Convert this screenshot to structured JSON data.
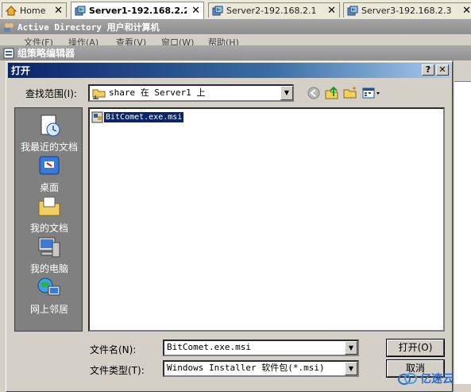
{
  "vmware_tabs": [
    {
      "label": "Home"
    },
    {
      "label": "Server1-192.168.2.2"
    },
    {
      "label": "Server2-192.168.2.1"
    },
    {
      "label": "Server3-192.168.2.3"
    }
  ],
  "ad_window": {
    "title": "Active Directory 用户和计算机",
    "menu": [
      "文件(F)",
      "操作(A)",
      "查看(V)",
      "窗口(W)",
      "帮助(H)"
    ]
  },
  "gpo_window": {
    "title": "组策略编辑器"
  },
  "dialog": {
    "title": "打开",
    "help_label": "?",
    "close_label": "✕",
    "look_in_label": "查找范围(I):",
    "look_in_value": "share 在 Server1 上",
    "places": [
      {
        "label": "我最近的文档",
        "icon": "recent-documents-icon"
      },
      {
        "label": "桌面",
        "icon": "desktop-icon"
      },
      {
        "label": "我的文档",
        "icon": "my-documents-icon"
      },
      {
        "label": "我的电脑",
        "icon": "my-computer-icon"
      },
      {
        "label": "网上邻居",
        "icon": "network-places-icon"
      }
    ],
    "files": [
      {
        "name": "BitComet.exe.msi",
        "selected": true
      }
    ],
    "filename_label": "文件名(N):",
    "filename_value": "BitComet.exe.msi",
    "filetype_label": "文件类型(T):",
    "filetype_value": "Windows Installer 软件包(*.msi)",
    "open_button": "打开(O)",
    "cancel_button": "取消"
  },
  "watermark": {
    "text": "亿速云"
  },
  "colors": {
    "dialog_title": "#0a246a",
    "face": "#d4d0c8",
    "selection": "#0a246a"
  }
}
